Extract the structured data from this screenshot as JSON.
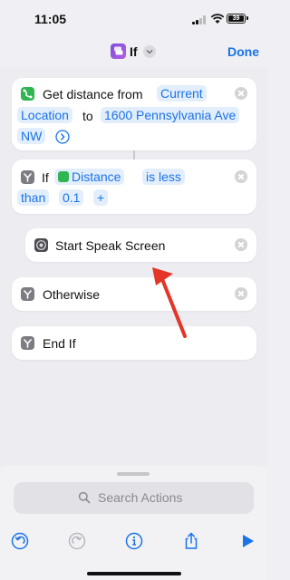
{
  "status_bar": {
    "time": "11:05",
    "battery": "39"
  },
  "nav": {
    "title": "If",
    "done_label": "Done"
  },
  "actions": {
    "get_distance": {
      "prefix": "Get distance from",
      "from_token": "Current",
      "from_token_line2": "Location",
      "to_label": "to",
      "to_token": "1600 Pennsylvania Ave",
      "to_token_line2": "NW"
    },
    "if_block": {
      "label": "If",
      "variable": "Distance",
      "condition": "is less",
      "condition_line2": "than",
      "value": "0.1",
      "add": "+"
    },
    "speak_screen": {
      "label": "Start Speak Screen"
    },
    "otherwise": {
      "label": "Otherwise"
    },
    "end_if": {
      "label": "End If"
    }
  },
  "search": {
    "placeholder": "Search Actions"
  },
  "colors": {
    "accent": "#1a73e8",
    "arrow": "#e53527",
    "green_icon": "#2fb551"
  }
}
